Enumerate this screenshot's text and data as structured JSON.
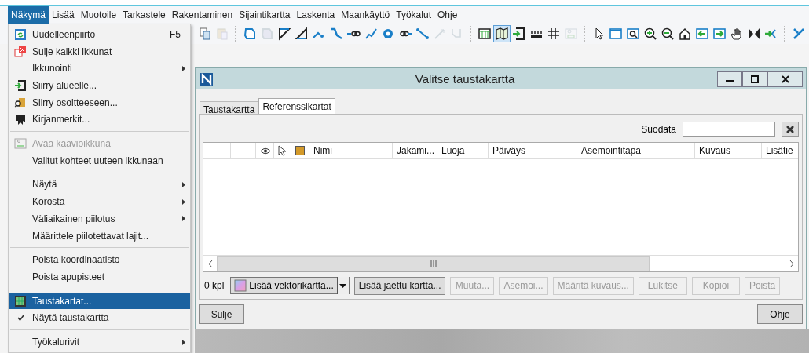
{
  "menubar": [
    {
      "label": "Näkymä",
      "selected": true
    },
    {
      "label": "Lisää",
      "selected": false
    },
    {
      "label": "Muotoile",
      "selected": false
    },
    {
      "label": "Tarkastele",
      "selected": false
    },
    {
      "label": "Rakentaminen",
      "selected": false
    },
    {
      "label": "Sijaintikartta",
      "selected": false
    },
    {
      "label": "Laskenta",
      "selected": false
    },
    {
      "label": "Maankäyttö",
      "selected": false
    },
    {
      "label": "Työkalut",
      "selected": false
    },
    {
      "label": "Ohje",
      "selected": false
    }
  ],
  "toolbar": [
    {
      "kind": "button",
      "disabled": false,
      "selected": false
    },
    {
      "kind": "button",
      "disabled": true,
      "selected": false
    },
    {
      "kind": "separator"
    },
    {
      "kind": "button",
      "disabled": false,
      "selected": false
    },
    {
      "kind": "button",
      "disabled": true,
      "selected": false
    },
    {
      "kind": "button",
      "disabled": false,
      "selected": false
    },
    {
      "kind": "button",
      "disabled": false,
      "selected": false
    },
    {
      "kind": "button",
      "disabled": false,
      "selected": false
    },
    {
      "kind": "button",
      "disabled": false,
      "selected": false
    },
    {
      "kind": "button",
      "disabled": false,
      "selected": false
    },
    {
      "kind": "button",
      "disabled": false,
      "selected": false
    },
    {
      "kind": "button",
      "disabled": false,
      "selected": false
    },
    {
      "kind": "button",
      "disabled": false,
      "selected": false
    },
    {
      "kind": "button",
      "disabled": false,
      "selected": false
    },
    {
      "kind": "button",
      "disabled": true,
      "selected": false
    },
    {
      "kind": "button",
      "disabled": true,
      "selected": false
    },
    {
      "kind": "separator"
    },
    {
      "kind": "button",
      "disabled": false,
      "selected": false
    },
    {
      "kind": "button",
      "disabled": false,
      "selected": true
    },
    {
      "kind": "button",
      "disabled": false,
      "selected": false
    },
    {
      "kind": "button",
      "disabled": false,
      "selected": false
    },
    {
      "kind": "button",
      "disabled": false,
      "selected": false
    },
    {
      "kind": "button",
      "disabled": true,
      "selected": false
    },
    {
      "kind": "separator"
    },
    {
      "kind": "button",
      "disabled": false,
      "selected": false
    },
    {
      "kind": "button",
      "disabled": false,
      "selected": false
    },
    {
      "kind": "button",
      "disabled": false,
      "selected": false
    },
    {
      "kind": "button",
      "disabled": false,
      "selected": false
    },
    {
      "kind": "button",
      "disabled": false,
      "selected": false
    },
    {
      "kind": "button",
      "disabled": false,
      "selected": false
    },
    {
      "kind": "button",
      "disabled": false,
      "selected": false
    },
    {
      "kind": "button",
      "disabled": false,
      "selected": false
    },
    {
      "kind": "button",
      "disabled": false,
      "selected": false
    },
    {
      "kind": "button",
      "disabled": false,
      "selected": false
    },
    {
      "kind": "button",
      "disabled": false,
      "selected": false
    },
    {
      "kind": "separator"
    },
    {
      "kind": "button",
      "disabled": false,
      "selected": false
    }
  ],
  "menu": [
    {
      "kind": "item",
      "label": "Uudelleenpiirto",
      "shortcut": "F5",
      "submenu": false,
      "disabled": false,
      "checked": false,
      "selected": false
    },
    {
      "kind": "item",
      "label": "Sulje kaikki ikkunat",
      "submenu": false,
      "disabled": false,
      "checked": false,
      "selected": false
    },
    {
      "kind": "item",
      "label": "Ikkunointi",
      "submenu": true,
      "disabled": false,
      "checked": false,
      "selected": false
    },
    {
      "kind": "item",
      "label": "Siirry alueelle...",
      "submenu": false,
      "disabled": false,
      "checked": false,
      "selected": false
    },
    {
      "kind": "item",
      "label": "Siirry osoitteeseen...",
      "submenu": false,
      "disabled": false,
      "checked": false,
      "selected": false
    },
    {
      "kind": "item",
      "label": "Kirjanmerkit...",
      "submenu": false,
      "disabled": false,
      "checked": false,
      "selected": false
    },
    {
      "kind": "separator"
    },
    {
      "kind": "item",
      "label": "Avaa kaavioikkuna",
      "submenu": false,
      "disabled": true,
      "checked": false,
      "selected": false
    },
    {
      "kind": "item",
      "label": "Valitut kohteet uuteen ikkunaan",
      "submenu": false,
      "disabled": false,
      "checked": false,
      "selected": false
    },
    {
      "kind": "separator"
    },
    {
      "kind": "item",
      "label": "Näytä",
      "submenu": true,
      "disabled": false,
      "checked": false,
      "selected": false
    },
    {
      "kind": "item",
      "label": "Korosta",
      "submenu": true,
      "disabled": false,
      "checked": false,
      "selected": false
    },
    {
      "kind": "item",
      "label": "Väliaikainen piilotus",
      "submenu": true,
      "disabled": false,
      "checked": false,
      "selected": false
    },
    {
      "kind": "item",
      "label": "Määrittele piilotettavat lajit...",
      "submenu": false,
      "disabled": false,
      "checked": false,
      "selected": false
    },
    {
      "kind": "separator"
    },
    {
      "kind": "item",
      "label": "Poista koordinaatisto",
      "submenu": false,
      "disabled": false,
      "checked": false,
      "selected": false
    },
    {
      "kind": "item",
      "label": "Poista apupisteet",
      "submenu": false,
      "disabled": false,
      "checked": false,
      "selected": false
    },
    {
      "kind": "separator"
    },
    {
      "kind": "item",
      "label": "Taustakartat...",
      "submenu": false,
      "disabled": false,
      "checked": false,
      "selected": true
    },
    {
      "kind": "item",
      "label": "Näytä taustakartta",
      "submenu": false,
      "disabled": false,
      "checked": true,
      "selected": false
    },
    {
      "kind": "separator"
    },
    {
      "kind": "item",
      "label": "Työkalurivit",
      "submenu": true,
      "disabled": false,
      "checked": false,
      "selected": false
    }
  ],
  "dialog": {
    "title": "Valitse taustakartta",
    "tabs": [
      {
        "label": "Taustakartta",
        "selected": false
      },
      {
        "label": "Referenssikartat",
        "selected": true
      }
    ],
    "filter_label": "Suodata",
    "table": {
      "columns": [
        "",
        "",
        "",
        "",
        "",
        "Nimi",
        "Jakami...",
        "Luoja",
        "Päiväys",
        "Asemointitapa",
        "Kuvaus",
        "Lisätie"
      ]
    },
    "count": "0 kpl",
    "add_combo": "Lisää vektorikartta...",
    "buttons": [
      {
        "label": "Lisää jaettu kartta...",
        "disabled": false
      },
      {
        "label": "Muuta...",
        "disabled": true
      },
      {
        "label": "Asemoi...",
        "disabled": true
      },
      {
        "label": "Määritä kuvaus...",
        "disabled": true
      },
      {
        "label": "Lukitse",
        "disabled": true
      },
      {
        "label": "Kopioi",
        "disabled": true
      },
      {
        "label": "Poista",
        "disabled": true
      }
    ],
    "footer_buttons": [
      "Sulje",
      "Ohje"
    ]
  }
}
